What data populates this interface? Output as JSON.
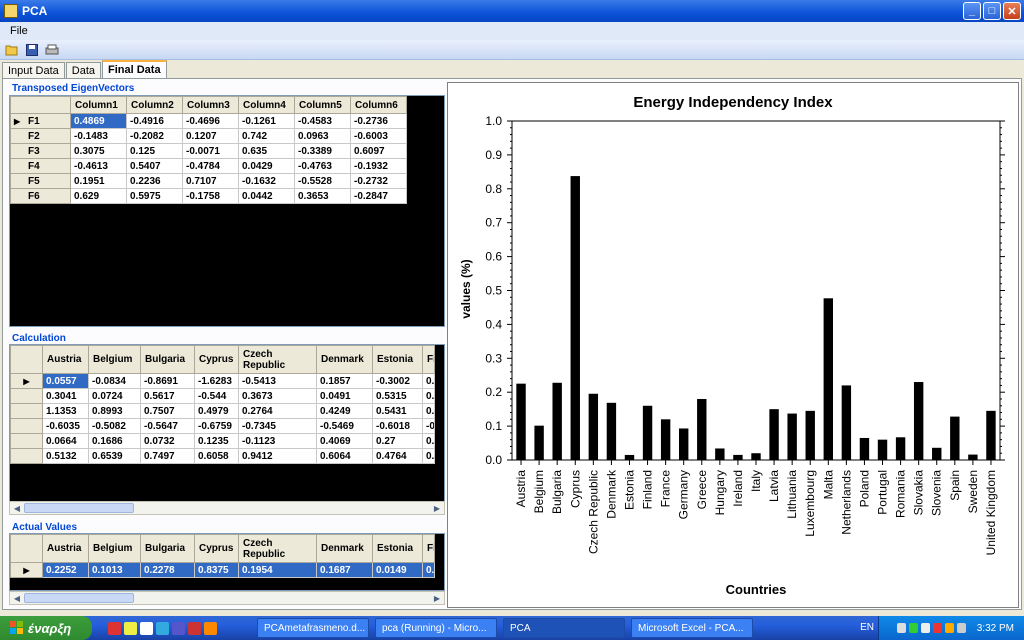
{
  "window": {
    "title": "PCA",
    "minimize": "_",
    "maximize": "□",
    "close": "✕"
  },
  "menu": {
    "file": "File"
  },
  "tabs": [
    "Input Data",
    "Data",
    "Final Data"
  ],
  "eigen": {
    "label": "Transposed EigenVectors",
    "columns": [
      "Column1",
      "Column2",
      "Column3",
      "Column4",
      "Column5",
      "Column6"
    ],
    "rows": [
      {
        "name": "F1",
        "values": [
          "0.4869",
          "-0.4916",
          "-0.4696",
          "-0.1261",
          "-0.4583",
          "-0.2736"
        ]
      },
      {
        "name": "F2",
        "values": [
          "-0.1483",
          "-0.2082",
          "0.1207",
          "0.742",
          "0.0963",
          "-0.6003"
        ]
      },
      {
        "name": "F3",
        "values": [
          "0.3075",
          "0.125",
          "-0.0071",
          "0.635",
          "-0.3389",
          "0.6097"
        ]
      },
      {
        "name": "F4",
        "values": [
          "-0.4613",
          "0.5407",
          "-0.4784",
          "0.0429",
          "-0.4763",
          "-0.1932"
        ]
      },
      {
        "name": "F5",
        "values": [
          "0.1951",
          "0.2236",
          "0.7107",
          "-0.1632",
          "-0.5528",
          "-0.2732"
        ]
      },
      {
        "name": "F6",
        "values": [
          "0.629",
          "0.5975",
          "-0.1758",
          "0.0442",
          "0.3653",
          "-0.2847"
        ]
      }
    ]
  },
  "calc": {
    "label": "Calculation",
    "columns": [
      "Austria",
      "Belgium",
      "Bulgaria",
      "Cyprus",
      "Czech Republic",
      "Denmark",
      "Estonia",
      "Fi"
    ],
    "rows": [
      [
        "0.0557",
        "-0.0834",
        "-0.8691",
        "-1.6283",
        "-0.5413",
        "0.1857",
        "-0.3002",
        "0.2"
      ],
      [
        "0.3041",
        "0.0724",
        "0.5617",
        "-0.544",
        "0.3673",
        "0.0491",
        "0.5315",
        "0.0"
      ],
      [
        "1.1353",
        "0.8993",
        "0.7507",
        "0.4979",
        "0.2764",
        "0.4249",
        "0.5431",
        "0.1"
      ],
      [
        "-0.6035",
        "-0.5082",
        "-0.5647",
        "-0.6759",
        "-0.7345",
        "-0.5469",
        "-0.6018",
        "-0"
      ],
      [
        "0.0664",
        "0.1686",
        "0.0732",
        "0.1235",
        "-0.1123",
        "0.4069",
        "0.27",
        "0.1"
      ],
      [
        "0.5132",
        "0.6539",
        "0.7497",
        "0.6058",
        "0.9412",
        "0.6064",
        "0.4764",
        "0.6"
      ]
    ]
  },
  "actual": {
    "label": "Actual Values",
    "columns": [
      "Austria",
      "Belgium",
      "Bulgaria",
      "Cyprus",
      "Czech Republic",
      "Denmark",
      "Estonia",
      "Fi"
    ],
    "rows": [
      [
        "0.2252",
        "0.1013",
        "0.2278",
        "0.8375",
        "0.1954",
        "0.1687",
        "0.0149",
        "0.1"
      ]
    ]
  },
  "chart_data": {
    "type": "bar",
    "title": "Energy Independency Index",
    "xlabel": "Countries",
    "ylabel": "values (%)",
    "ylim": [
      0,
      1.0
    ],
    "yticks": [
      "0.0",
      "0.1",
      "0.2",
      "0.3",
      "0.4",
      "0.5",
      "0.6",
      "0.7",
      "0.8",
      "0.9",
      "1.0"
    ],
    "grid": false,
    "color": "#000000",
    "categories": [
      "Austria",
      "Belgium",
      "Bulgaria",
      "Cyprus",
      "Czech Republic",
      "Denmark",
      "Estonia",
      "Finland",
      "France",
      "Germany",
      "Greece",
      "Hungary",
      "Ireland",
      "Italy",
      "Latvia",
      "Lithuania",
      "Luxembourg",
      "Malta",
      "Netherlands",
      "Poland",
      "Portugal",
      "Romania",
      "Slovakia",
      "Slovenia",
      "Spain",
      "Sweden",
      "United Kingdom"
    ],
    "values": [
      0.2252,
      0.1013,
      0.2278,
      0.8375,
      0.1954,
      0.1687,
      0.0149,
      0.16,
      0.12,
      0.093,
      0.18,
      0.034,
      0.015,
      0.02,
      0.15,
      0.137,
      0.145,
      0.477,
      0.22,
      0.065,
      0.06,
      0.067,
      0.23,
      0.036,
      0.128,
      0.016,
      0.145
    ]
  },
  "taskbar": {
    "start": "έναρξη",
    "tasks": [
      "PCAmetafrasmeno.d...",
      "pca (Running) - Micro...",
      "PCA",
      "Microsoft Excel - PCA..."
    ],
    "lang": "EN",
    "clock": "3:32 PM"
  }
}
